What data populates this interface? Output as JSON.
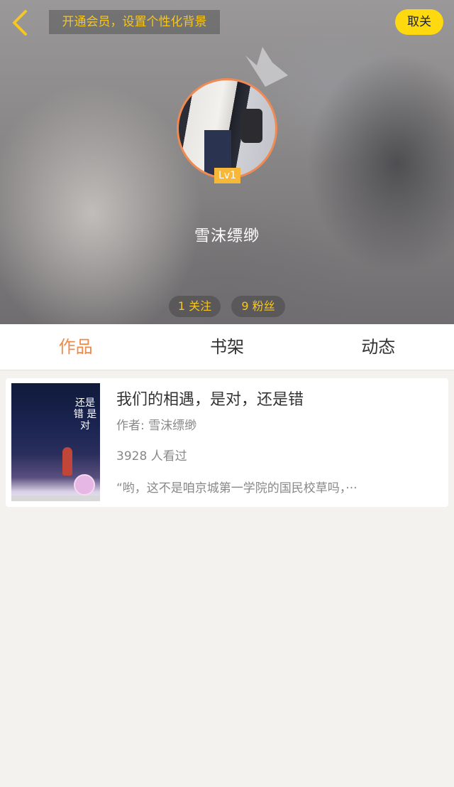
{
  "header": {
    "vip_banner": "开通会员，设置个性化背景",
    "unfollow_label": "取关",
    "level": "Lv1",
    "username": "雪沫缥缈",
    "follow_stat": "1 关注",
    "fans_stat": "9 粉丝"
  },
  "tabs": [
    {
      "label": "作品",
      "active": true
    },
    {
      "label": "书架",
      "active": false
    },
    {
      "label": "动态",
      "active": false
    }
  ],
  "book": {
    "title": "我们的相遇，是对，还是错",
    "author": "作者: 雪沫缥缈",
    "views": "3928 人看过",
    "excerpt": "“哟，这不是咱京城第一学院的国民校草吗，···",
    "cover_text": "还是错 是对"
  },
  "colors": {
    "accent": "#f08a4b",
    "button_yellow": "#ffd90f",
    "stat_text": "#f6c622"
  }
}
